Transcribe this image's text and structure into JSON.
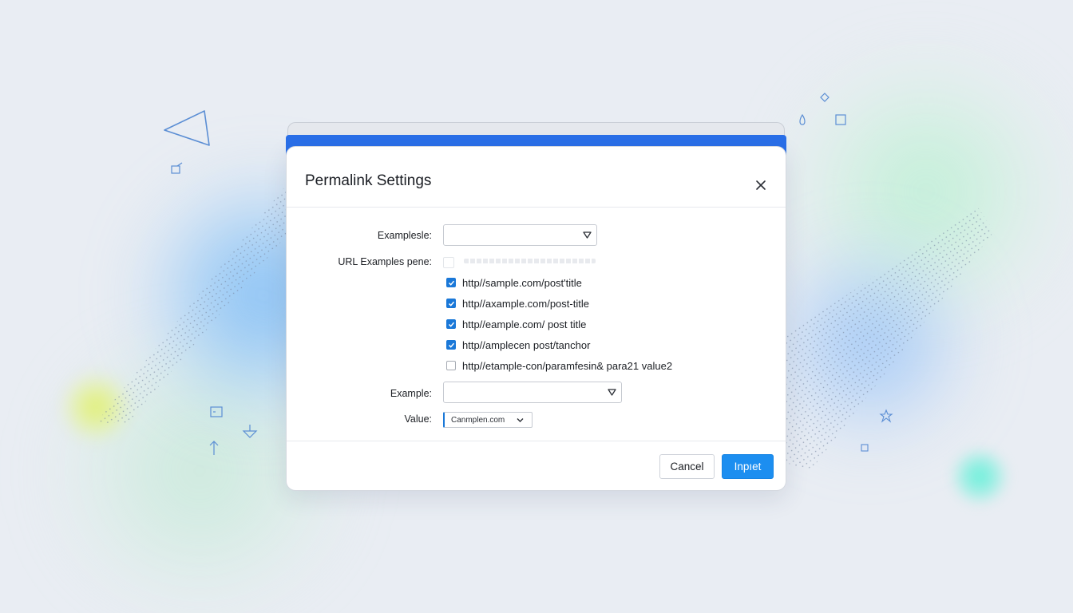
{
  "dialog": {
    "title": "Permalink Settings",
    "close_icon": "close-icon"
  },
  "form": {
    "examples_label": "Examplesle:",
    "examples_value": "",
    "url_examples_label": "URL Examples pene:",
    "options": [
      {
        "label": "http//sample.com/post'title",
        "checked": true
      },
      {
        "label": "http//axample.com/post-title",
        "checked": true
      },
      {
        "label": "http//eample.com/ post title",
        "checked": true
      },
      {
        "label": "http//amplecen post/tanchor",
        "checked": true
      },
      {
        "label": "http//etample-con/paramfesin& para21 value2",
        "checked": false
      }
    ],
    "example_label": "Example:",
    "example_value": "",
    "value_label": "Value:",
    "value_selected": "Canmplen.com"
  },
  "footer": {
    "cancel_label": "Cancel",
    "primary_label": "Inpıet"
  },
  "colors": {
    "accent": "#2a6fe8",
    "primary_button": "#1c8ef0",
    "checkbox": "#1a78d8"
  }
}
